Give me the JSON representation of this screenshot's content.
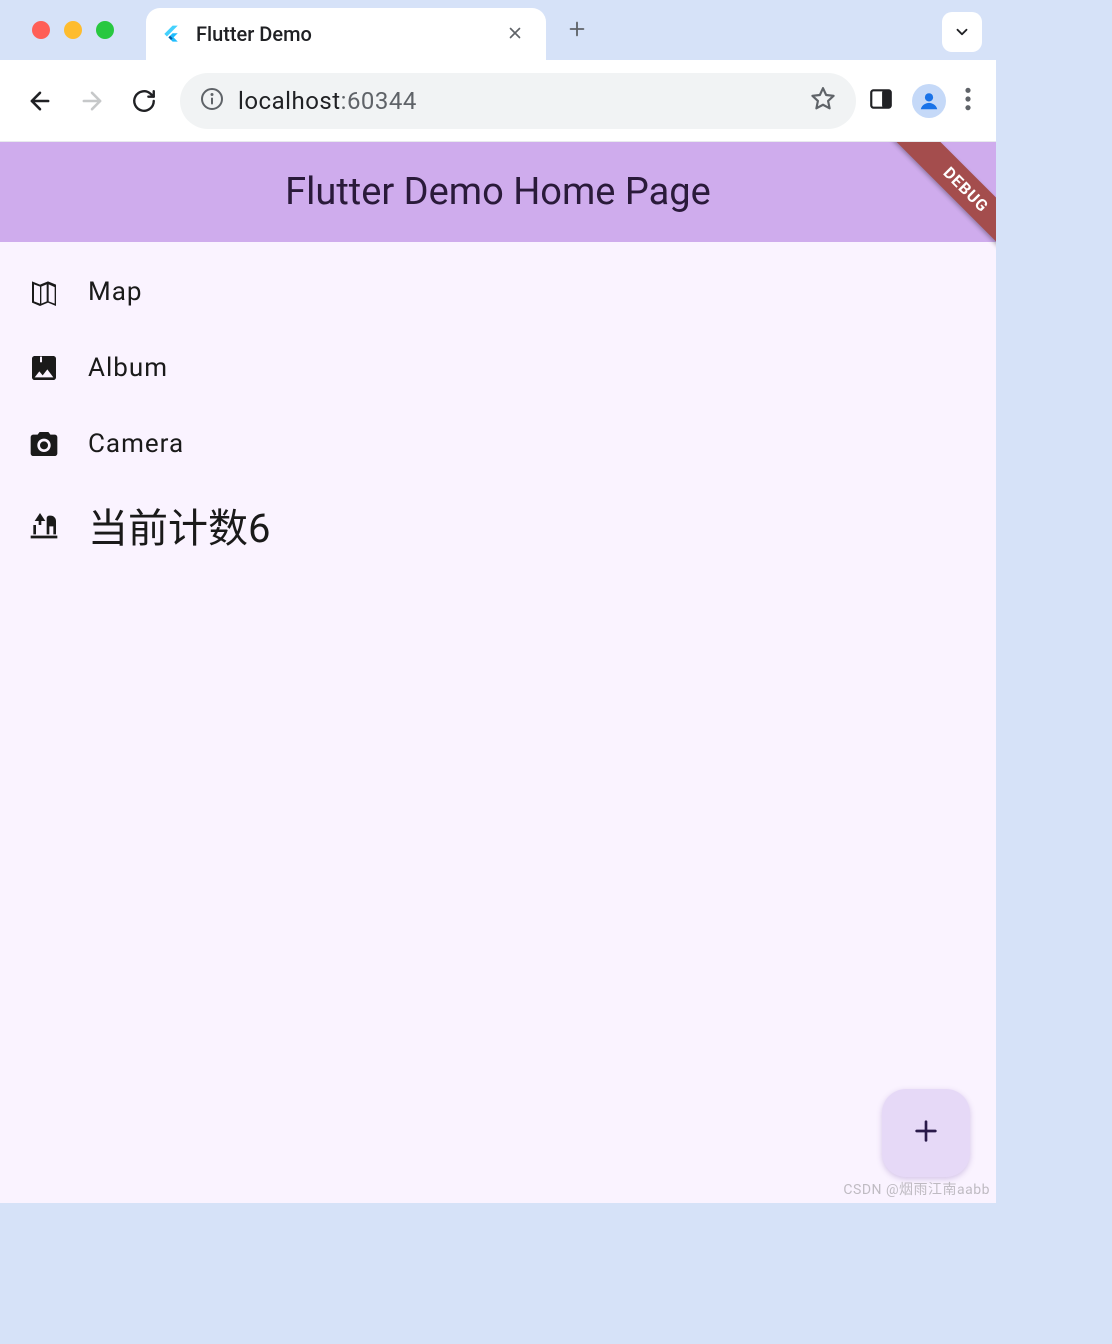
{
  "browser": {
    "tab_title": "Flutter Demo",
    "url_host": "localhost",
    "url_port": ":60344"
  },
  "appbar": {
    "title": "Flutter Demo Home Page",
    "debug_label": "DEBUG"
  },
  "list": {
    "items": [
      {
        "label": "Map"
      },
      {
        "label": "Album"
      },
      {
        "label": "Camera"
      }
    ],
    "count_label": "当前计数6"
  },
  "watermark": "CSDN @烟雨江南aabb",
  "colors": {
    "appbar_bg": "#cfaced",
    "viewport_bg": "#faf3ff",
    "fab_bg": "#e6d9f7",
    "debug_bg": "#a44d4d"
  }
}
